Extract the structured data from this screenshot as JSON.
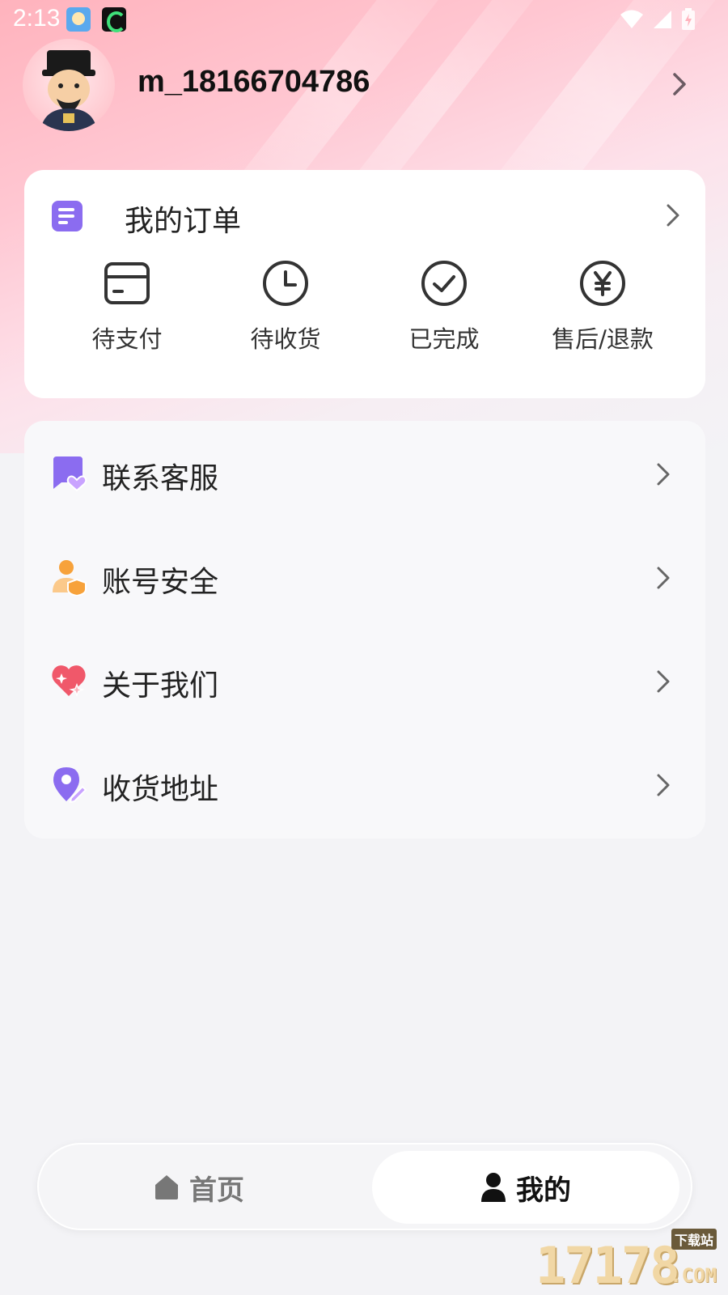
{
  "status_bar": {
    "time": "2:13"
  },
  "profile": {
    "username": "m_18166704786"
  },
  "orders": {
    "title": "我的订单",
    "items": [
      {
        "label": "待支付",
        "icon": "card-icon"
      },
      {
        "label": "待收货",
        "icon": "clock-icon"
      },
      {
        "label": "已完成",
        "icon": "check-circle-icon"
      },
      {
        "label": "售后/退款",
        "icon": "yen-circle-icon"
      }
    ]
  },
  "menu": {
    "items": [
      {
        "label": "联系客服",
        "icon": "chat-heart-icon"
      },
      {
        "label": "账号安全",
        "icon": "user-shield-icon"
      },
      {
        "label": "关于我们",
        "icon": "heart-sparkle-icon"
      },
      {
        "label": "收货地址",
        "icon": "location-pin-icon"
      }
    ]
  },
  "bottom_nav": {
    "home_label": "首页",
    "mine_label": "我的",
    "active": "mine"
  },
  "watermark": {
    "number": "17178",
    "sub": "下载站",
    "suffix": ".COM"
  },
  "colors": {
    "accent_purple": "#8b6cf0",
    "orange": "#f7a23b",
    "pink_red": "#f0586a",
    "header_pink": "#ffb3bd"
  }
}
